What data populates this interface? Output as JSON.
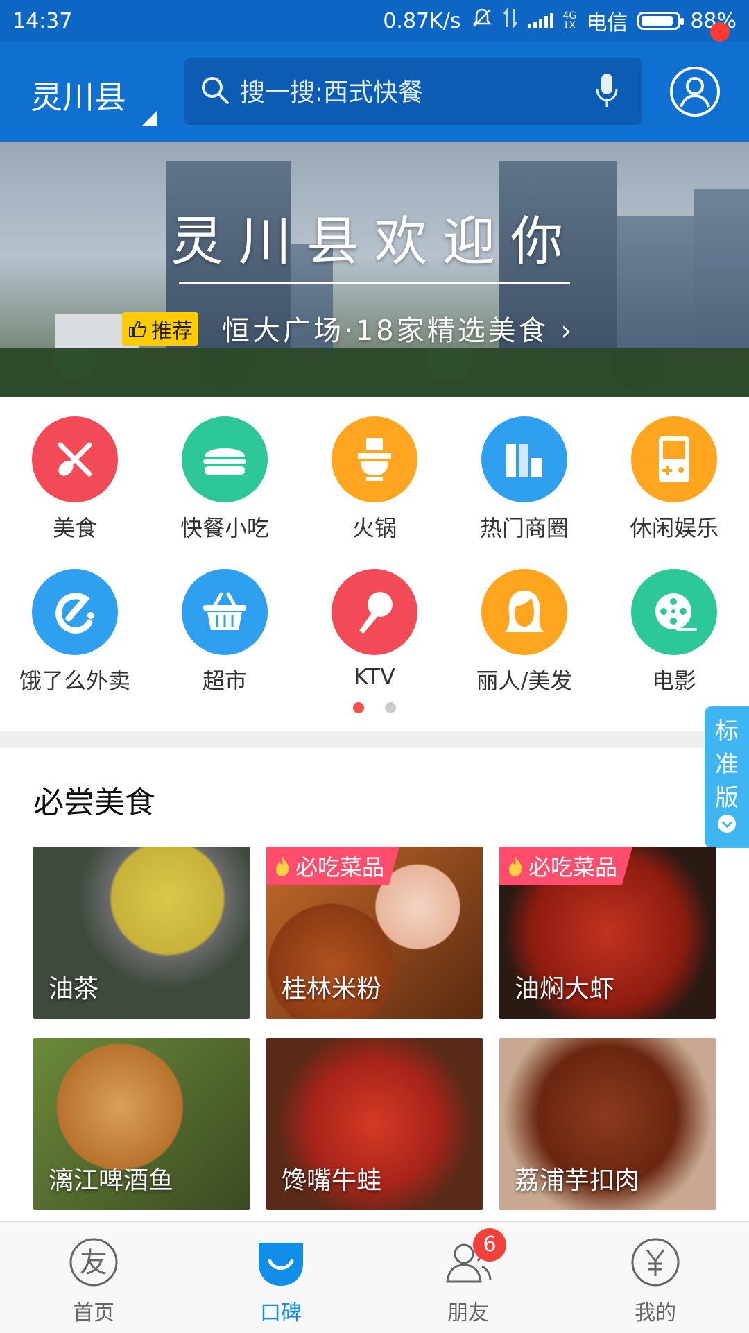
{
  "status_bar": {
    "time": "14:37",
    "net_speed": "0.87K/s",
    "net_4g": "4G",
    "net_1x": "1X",
    "carrier": "电信",
    "battery": "88%",
    "battery_level": 0.88
  },
  "header": {
    "city": "灵川县",
    "search_placeholder": "搜一搜:西式快餐"
  },
  "banner": {
    "title": "灵川县欢迎你",
    "recommend_tag": "推荐",
    "recommend_text": "恒大广场·18家精选美食 ›"
  },
  "categories": [
    {
      "label": "美食",
      "color": "#f24b57",
      "icon": "fork-spoon-icon"
    },
    {
      "label": "快餐小吃",
      "color": "#2ec79a",
      "icon": "burger-icon"
    },
    {
      "label": "火锅",
      "color": "#ffa51f",
      "icon": "hotpot-icon"
    },
    {
      "label": "热门商圈",
      "color": "#2f9ff0",
      "icon": "buildings-icon"
    },
    {
      "label": "休闲娱乐",
      "color": "#ffa51f",
      "icon": "gameboy-icon"
    },
    {
      "label": "饿了么外卖",
      "color": "#2f9ff0",
      "icon": "eleme-icon"
    },
    {
      "label": "超市",
      "color": "#2f9ff0",
      "icon": "basket-icon"
    },
    {
      "label": "KTV",
      "color": "#f24b57",
      "icon": "microphone-icon"
    },
    {
      "label": "丽人/美发",
      "color": "#ffa51f",
      "icon": "woman-hair-icon"
    },
    {
      "label": "电影",
      "color": "#2ec79a",
      "icon": "film-reel-icon"
    }
  ],
  "side_tab": {
    "line1": "标",
    "line2": "准",
    "line3": "版"
  },
  "section": {
    "title": "必尝美食",
    "foods": [
      {
        "name": "油茶",
        "tag": ""
      },
      {
        "name": "桂林米粉",
        "tag": "必吃菜品"
      },
      {
        "name": "油焖大虾",
        "tag": "必吃菜品"
      },
      {
        "name": "漓江啤酒鱼",
        "tag": ""
      },
      {
        "name": "馋嘴牛蛙",
        "tag": ""
      },
      {
        "name": "荔浦芋扣肉",
        "tag": ""
      }
    ]
  },
  "tabbar": {
    "items": [
      {
        "label": "首页"
      },
      {
        "label": "口碑"
      },
      {
        "label": "朋友"
      },
      {
        "label": "我的"
      }
    ],
    "friends_badge": "6"
  },
  "colors": {
    "header_blue": "#0f70d2",
    "accent": "#108ee9",
    "tag_pink": "#ff4d6d",
    "recommend_yellow": "#ffcc00"
  }
}
